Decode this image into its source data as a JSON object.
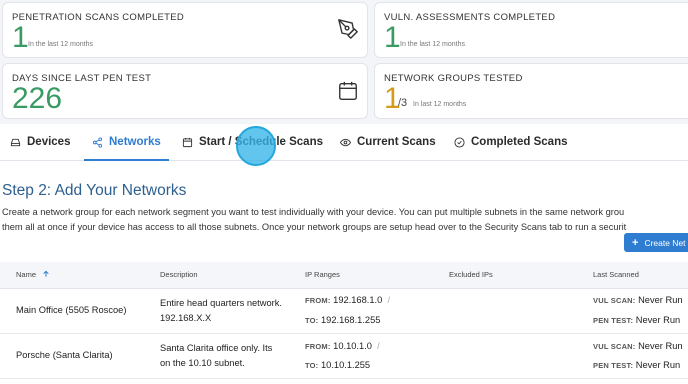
{
  "cards": {
    "pen_scans": {
      "title": "PENETRATION SCANS COMPLETED",
      "value": "1",
      "sub": "In the last 12 months",
      "icon": "pen-nib-icon"
    },
    "vuln": {
      "title": "VULN. ASSESSMENTS COMPLETED",
      "value": "1",
      "sub": "In the last 12 months"
    },
    "days": {
      "title": "DAYS SINCE LAST PEN TEST",
      "value": "226",
      "icon": "calendar-icon"
    },
    "groups": {
      "title": "NETWORK GROUPS TESTED",
      "value": "1",
      "total": "/3",
      "sub": "In last 12 months"
    }
  },
  "tabs": [
    {
      "label": "Devices",
      "icon": "device-icon"
    },
    {
      "label": "Networks",
      "icon": "network-icon",
      "active": true
    },
    {
      "label": "Start / Schedule Scans",
      "icon": "calendar-icon"
    },
    {
      "label": "Current Scans",
      "icon": "eye-icon"
    },
    {
      "label": "Completed Scans",
      "icon": "check-circle-icon"
    }
  ],
  "main": {
    "title": "Step 2: Add Your Networks",
    "desc_line1": "Create a network group for each network segment you want to test individually with your device. You can put multiple subnets in the same network grou",
    "desc_line2": "them all at once if your device has access to all those subnets. Once your network groups are setup head over to the Security Scans tab to run a securit",
    "create_button": "Create Net"
  },
  "table": {
    "headers": {
      "name": "Name",
      "description": "Description",
      "ip_ranges": "IP Ranges",
      "excluded": "Excluded IPs",
      "last_scanned": "Last Scanned"
    },
    "from_label": "FROM:",
    "to_label": "TO:",
    "vul_label": "VUL SCAN:",
    "pen_label": "PEN TEST:",
    "rows": [
      {
        "name": "Main Office (5505 Roscoe)",
        "desc1": "Entire head quarters network.",
        "desc2": "192.168.X.X",
        "from": "192.168.1.0",
        "to": "192.168.1.255",
        "vul": "Never Run",
        "pen": "Never Run"
      },
      {
        "name": "Porsche (Santa Clarita)",
        "desc1": "Santa Clarita office only. Its",
        "desc2": "on the 10.10 subnet.",
        "from": "10.10.1.0",
        "to": "10.10.1.255",
        "vul": "Never Run",
        "pen": "Never Run"
      }
    ]
  },
  "colors": {
    "accent": "#2f7dd1",
    "green": "#3a9a63",
    "gold": "#d69a1a",
    "cursor": "#34b5e8"
  }
}
